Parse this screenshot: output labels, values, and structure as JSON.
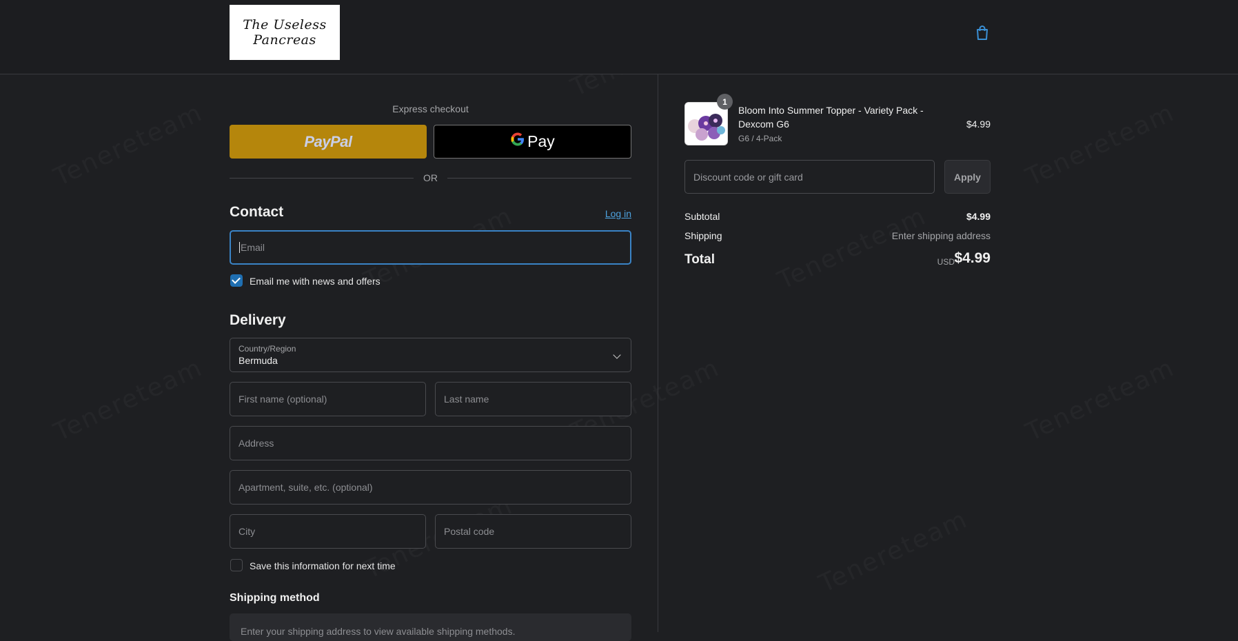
{
  "header": {
    "logo_line1": "The Useless",
    "logo_line2": "Pancreas",
    "cart_icon": "shopping-bag-icon"
  },
  "express": {
    "label": "Express checkout",
    "paypal_label": "PayPal",
    "gpay_g": "G",
    "gpay_label": "Pay",
    "or_label": "OR"
  },
  "contact": {
    "title": "Contact",
    "login_label": "Log in",
    "email_placeholder": "Email",
    "newsletter_label": "Email me with news and offers",
    "newsletter_checked": true
  },
  "delivery": {
    "title": "Delivery",
    "country_label": "Country/Region",
    "country_value": "Bermuda",
    "first_name_placeholder": "First name (optional)",
    "last_name_placeholder": "Last name",
    "address_placeholder": "Address",
    "apartment_placeholder": "Apartment, suite, etc. (optional)",
    "city_placeholder": "City",
    "postal_placeholder": "Postal code",
    "save_info_label": "Save this information for next time",
    "save_info_checked": false
  },
  "shipping_method": {
    "title": "Shipping method",
    "message": "Enter your shipping address to view available shipping methods."
  },
  "order": {
    "item": {
      "quantity": "1",
      "title": "Bloom Into Summer Topper - Variety Pack - Dexcom G6",
      "variant": "G6 / 4-Pack",
      "price": "$4.99"
    },
    "discount_placeholder": "Discount code or gift card",
    "apply_label": "Apply",
    "subtotal_label": "Subtotal",
    "subtotal_value": "$4.99",
    "shipping_label": "Shipping",
    "shipping_value": "Enter shipping address",
    "total_label": "Total",
    "total_currency": "USD",
    "total_value": "$4.99"
  },
  "watermark_text": "Tenereteam",
  "colors": {
    "background": "#1e1f22",
    "accent_blue": "#3a84c7",
    "paypal_gold": "#b5860c",
    "link": "#4ea3e0"
  }
}
